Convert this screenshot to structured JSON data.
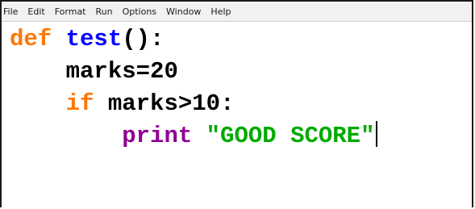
{
  "menubar": {
    "items": [
      "File",
      "Edit",
      "Format",
      "Run",
      "Options",
      "Window",
      "Help"
    ]
  },
  "code": {
    "line1": {
      "kw": "def",
      "space": " ",
      "name": "test",
      "rest": "():"
    },
    "line2": {
      "indent": "    ",
      "text": "marks=20"
    },
    "line3": {
      "indent": "    ",
      "kw": "if",
      "rest": " marks>10:"
    },
    "line4": {
      "indent": "        ",
      "builtin": "print",
      "space": " ",
      "str": "\"GOOD SCORE\""
    }
  },
  "colors": {
    "keyword": "#ff7700",
    "definition": "#0000ff",
    "string": "#00aa00",
    "builtin": "#900090",
    "menubar_bg": "#f1f1f1"
  }
}
